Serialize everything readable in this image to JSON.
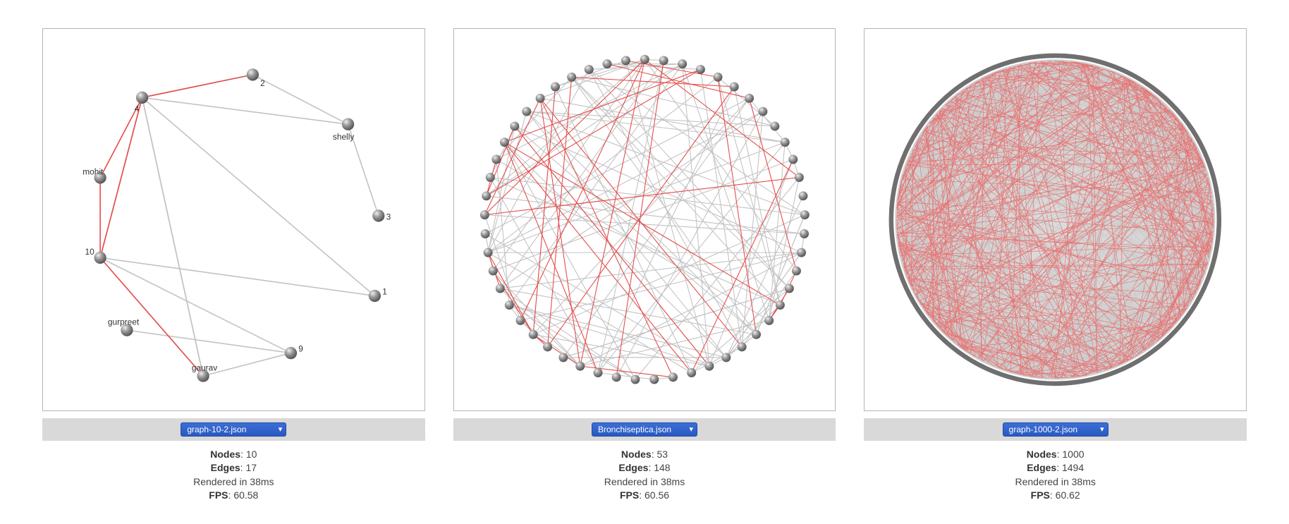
{
  "panels": [
    {
      "select_value": "graph-10-2.json",
      "stats": {
        "nodes_label": "Nodes",
        "nodes_value": "10",
        "edges_label": "Edges",
        "edges_value": "17",
        "rendered_text": "Rendered in 38ms",
        "fps_label": "FPS",
        "fps_value": "60.58"
      },
      "graph": {
        "node_labels": [
          "1",
          "2",
          "3",
          "4",
          "9",
          "10",
          "mohit",
          "shelly",
          "gaurav",
          "gurpreet"
        ],
        "edge_count": 17
      }
    },
    {
      "select_value": "Bronchiseptica.json",
      "stats": {
        "nodes_label": "Nodes",
        "nodes_value": "53",
        "edges_label": "Edges",
        "edges_value": "148",
        "rendered_text": "Rendered in 38ms",
        "fps_label": "FPS",
        "fps_value": "60.56"
      },
      "graph": {
        "node_labels": [],
        "edge_count": 148
      }
    },
    {
      "select_value": "graph-1000-2.json",
      "stats": {
        "nodes_label": "Nodes",
        "nodes_value": "1000",
        "edges_label": "Edges",
        "edges_value": "1494",
        "rendered_text": "Rendered in 38ms",
        "fps_label": "FPS",
        "fps_value": "60.62"
      },
      "graph": {
        "node_labels": [],
        "edge_count": 1494
      }
    }
  ],
  "colors": {
    "node_fill": "#8a8a8a",
    "node_hi": "#c8c8c8",
    "edge_grey": "#c3c3c3",
    "edge_red": "#e64b4b",
    "select_blue": "#2a59c0"
  }
}
